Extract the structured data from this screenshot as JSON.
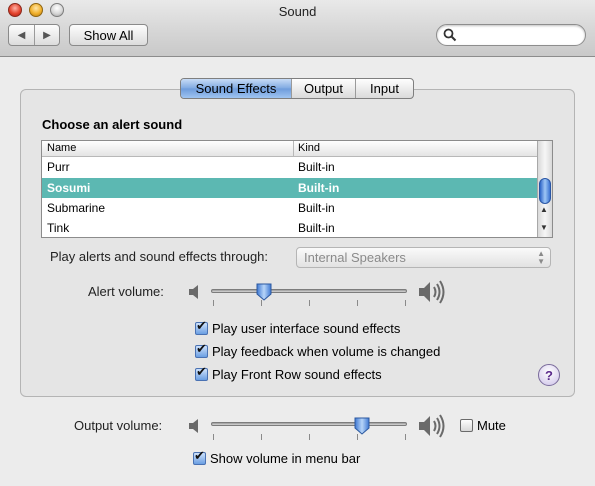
{
  "window": {
    "title": "Sound"
  },
  "toolbar": {
    "back_icon": "left-arrow",
    "forward_icon": "right-arrow",
    "show_all_label": "Show All",
    "search_placeholder": ""
  },
  "tabs": [
    {
      "label": "Sound Effects",
      "selected": true
    },
    {
      "label": "Output",
      "selected": false
    },
    {
      "label": "Input",
      "selected": false
    }
  ],
  "alert_section": {
    "heading": "Choose an alert sound",
    "columns": [
      "Name",
      "Kind"
    ],
    "rows": [
      {
        "name": "Purr",
        "kind": "Built-in",
        "selected": false
      },
      {
        "name": "Sosumi",
        "kind": "Built-in",
        "selected": true
      },
      {
        "name": "Submarine",
        "kind": "Built-in",
        "selected": false
      },
      {
        "name": "Tink",
        "kind": "Built-in",
        "selected": false
      }
    ]
  },
  "play_through": {
    "label": "Play alerts and sound effects through:",
    "value": "Internal Speakers"
  },
  "alert_volume": {
    "label": "Alert volume:",
    "level": 0.27
  },
  "checkboxes": {
    "ui_sounds": {
      "label": "Play user interface sound effects",
      "checked": true
    },
    "feedback": {
      "label": "Play feedback when volume is changed",
      "checked": true
    },
    "front_row": {
      "label": "Play Front Row sound effects",
      "checked": true
    }
  },
  "help_label": "?",
  "output_volume": {
    "label": "Output volume:",
    "level": 0.77,
    "mute_label": "Mute",
    "mute_checked": false
  },
  "menu_bar": {
    "label": "Show volume in menu bar",
    "checked": true
  },
  "colors": {
    "selected_row": "#5cb8b2",
    "selected_tab": "#7ea9e2"
  }
}
